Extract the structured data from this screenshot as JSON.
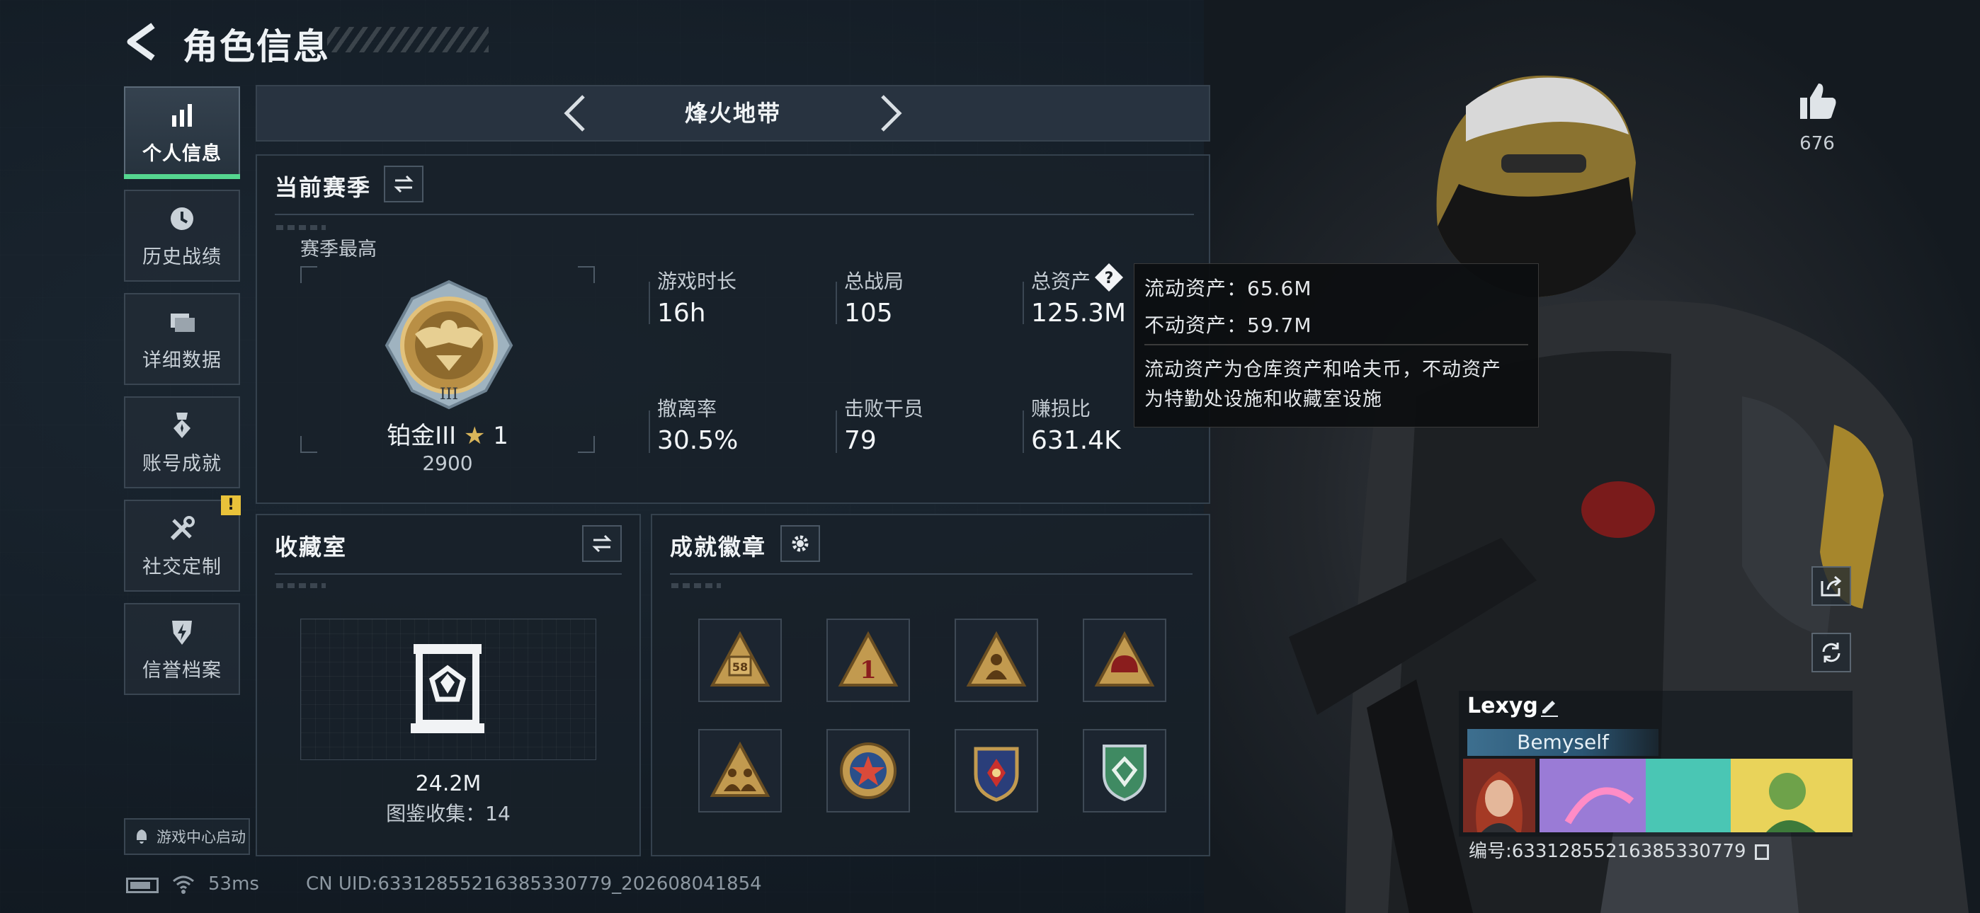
{
  "header": {
    "title": "角色信息"
  },
  "sidebar": {
    "items": [
      {
        "label": "个人信息",
        "icon": "bar-chart-icon"
      },
      {
        "label": "历史战绩",
        "icon": "history-clock-icon"
      },
      {
        "label": "详细数据",
        "icon": "folder-icon"
      },
      {
        "label": "账号成就",
        "icon": "medal-icon"
      },
      {
        "label": "社交定制",
        "icon": "tools-icon",
        "badge": "!"
      },
      {
        "label": "信誉档案",
        "icon": "shield-icon"
      }
    ],
    "game_center_label": "游戏中心启动"
  },
  "mode": {
    "label": "烽火地带"
  },
  "season": {
    "title": "当前赛季",
    "best_label": "赛季最高",
    "rank": "铂金III",
    "stars": "1",
    "score": "2900",
    "stats": [
      {
        "label": "游戏时长",
        "value": "16h"
      },
      {
        "label": "总战局",
        "value": "105"
      },
      {
        "label": "总资产",
        "value": "125.3M"
      },
      {
        "label": "撤离率",
        "value": "30.5%"
      },
      {
        "label": "击败干员",
        "value": "79"
      },
      {
        "label": "赚损比",
        "value": "631.4K"
      }
    ]
  },
  "tooltip": {
    "liquid": "流动资产：65.6M",
    "fixed": "不动资产：59.7M",
    "desc_line1": "流动资产为仓库资产和哈夫币，不动资产",
    "desc_line2": "为特勤处设施和收藏室设施"
  },
  "collection": {
    "title": "收藏室",
    "value": "24.2M",
    "count": "图鉴收集：14"
  },
  "achievements": {
    "title": "成就徽章",
    "badges": [
      {
        "icon": "badge-58-icon",
        "text": "58"
      },
      {
        "icon": "badge-number-one-icon",
        "text": "1"
      },
      {
        "icon": "badge-soldier-icon",
        "text": ""
      },
      {
        "icon": "badge-helmet-icon",
        "text": ""
      },
      {
        "icon": "badge-squad-icon",
        "text": ""
      },
      {
        "icon": "badge-star-icon",
        "text": ""
      },
      {
        "icon": "badge-crest-icon",
        "text": ""
      },
      {
        "icon": "badge-green-shield-icon",
        "text": ""
      }
    ]
  },
  "profile": {
    "likes": "676",
    "name": "Lexyg",
    "tagline": "Bemyself",
    "uid_label": "编号:6331285521638533077​9"
  },
  "footer": {
    "ping": "53ms",
    "uid": "CN UID:6331285521638533077​9_202608041854"
  },
  "colors": {
    "accent_green": "#55d690",
    "gold": "#c9a24a",
    "panel": "#18212a"
  }
}
